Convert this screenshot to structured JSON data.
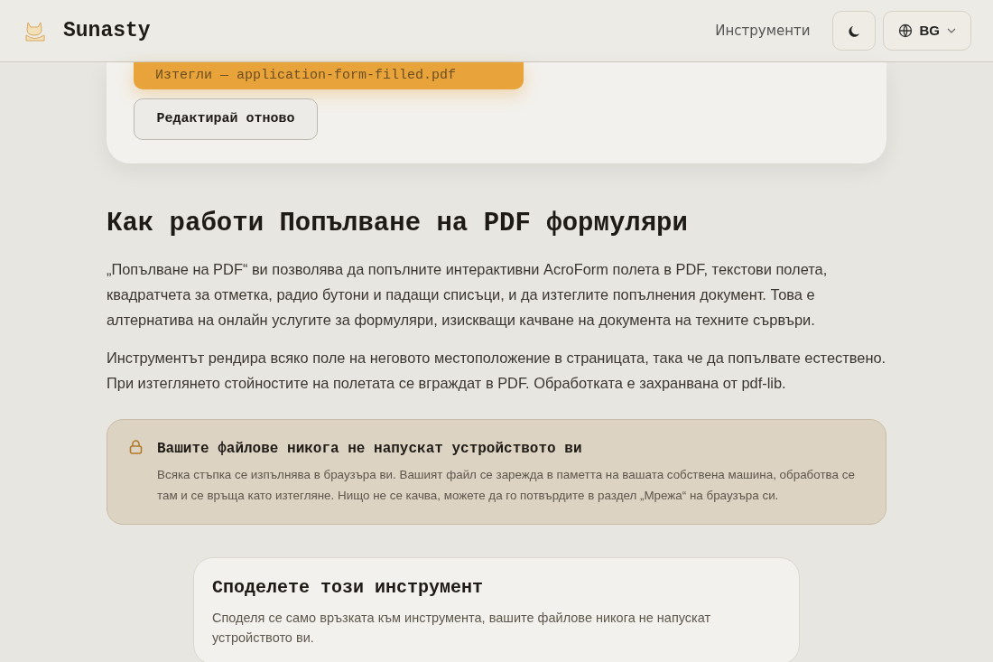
{
  "header": {
    "brand": "Sunasty",
    "nav_link": "Инструменти",
    "language": "BG"
  },
  "result_card": {
    "download_button": "Изтегли — application-form-filled.pdf",
    "edit_button": "Редактирай отново"
  },
  "how_it_works": {
    "title": "Как работи Попълване на PDF формуляри",
    "paragraphs": [
      "„Попълване на PDF“ ви позволява да попълните интерактивни AcroForm полета в PDF, текстови полета, квадратчета за отметка, радио бутони и падащи списъци, и да изтеглите попълнения документ. Това е алтернатива на онлайн услугите за формуляри, изискващи качване на документа на техните сървъри.",
      "Инструментът рендира всяко поле на неговото местоположение в страницата, така че да попълвате естествено. При изтеглянето стойностите на полетата се вграждат в PDF. Обработката е захранвана от pdf-lib."
    ]
  },
  "privacy_notice": {
    "title": "Вашите файлове никога не напускат устройството ви",
    "text": "Всяка стъпка се изпълнява в браузъра ви. Вашият файл се зарежда в паметта на вашата собствена машина, обработва се там и се връща като изтегляне. Нищо не се качва, можете да го потвърдите в раздел „Мрежа“ на браузъра си."
  },
  "share_card": {
    "title": "Споделете този инструмент",
    "text": "Споделя се само връзката към инструмента, вашите файлове никога не напускат устройството ви."
  }
}
